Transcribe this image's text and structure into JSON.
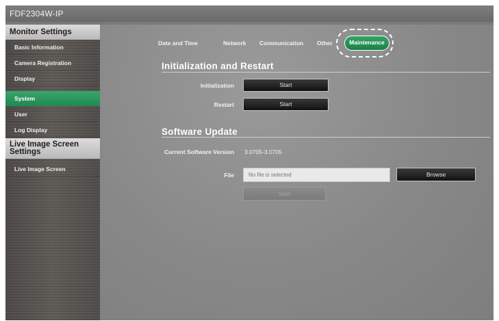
{
  "window": {
    "title": "FDF2304W-IP"
  },
  "sidebar": {
    "monitor_settings_header": "Monitor Settings",
    "items": [
      {
        "label": "Basic Information",
        "active": false
      },
      {
        "label": "Camera Registration",
        "active": false
      },
      {
        "label": "Display",
        "active": false
      },
      {
        "label": "System",
        "active": true
      },
      {
        "label": "User",
        "active": false
      },
      {
        "label": "Log Display",
        "active": false
      }
    ],
    "live_image_header": "Live Image Screen Settings",
    "live_items": [
      {
        "label": "Live Image Screen",
        "active": false
      }
    ],
    "active_color": "#2a9a5e"
  },
  "tabs": [
    {
      "label": "Date and Time",
      "active": false
    },
    {
      "label": "Network",
      "active": false
    },
    {
      "label": "Communication",
      "active": false
    },
    {
      "label": "Other",
      "active": false
    },
    {
      "label": "Maintenance",
      "active": true
    }
  ],
  "initialization_section": {
    "title": "Initialization and Restart",
    "initialization_label": "Initialization",
    "initialization_button": "Start",
    "restart_label": "Restart",
    "restart_button": "Start"
  },
  "software_update_section": {
    "title": "Software Update",
    "current_version_label": "Current Software Version",
    "current_version_value": "3.0705-3.0705",
    "file_label": "File",
    "file_placeholder": "No file is selected",
    "browse_button": "Browse",
    "start_button": "Start",
    "start_enabled": false
  }
}
